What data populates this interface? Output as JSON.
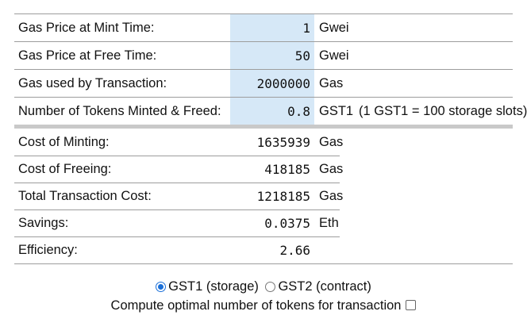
{
  "rows": {
    "mint_price": {
      "label": "Gas Price at Mint Time:",
      "value": "1",
      "unit": "Gwei"
    },
    "free_price": {
      "label": "Gas Price at Free Time:",
      "value": "50",
      "unit": "Gwei"
    },
    "gas_used": {
      "label": "Gas used by Transaction:",
      "value": "2000000",
      "unit": "Gas"
    },
    "tokens": {
      "label": "Number of Tokens Minted & Freed:",
      "value": "0.8",
      "unit": "GST1",
      "note": "(1 GST1 = 100 storage slots)"
    },
    "cost_minting": {
      "label": "Cost of Minting:",
      "value": "1635939",
      "unit": "Gas"
    },
    "cost_freeing": {
      "label": "Cost of Freeing:",
      "value": "418185",
      "unit": "Gas"
    },
    "total_cost": {
      "label": "Total Transaction Cost:",
      "value": "1218185",
      "unit": "Gas"
    },
    "savings": {
      "label": "Savings:",
      "value": "0.0375",
      "unit": "Eth"
    },
    "efficiency": {
      "label": "Efficiency:",
      "value": "2.66",
      "unit": ""
    }
  },
  "token_type": {
    "options": [
      "GST1 (storage)",
      "GST2 (contract)"
    ],
    "selected": "GST1 (storage)"
  },
  "optimal": {
    "label": "Compute optimal number of tokens for transaction",
    "checked": false
  },
  "colors": {
    "input_bg": "#d6e8f7",
    "divider": "#9d9d9d",
    "radio_accent": "#1a6fd8"
  }
}
